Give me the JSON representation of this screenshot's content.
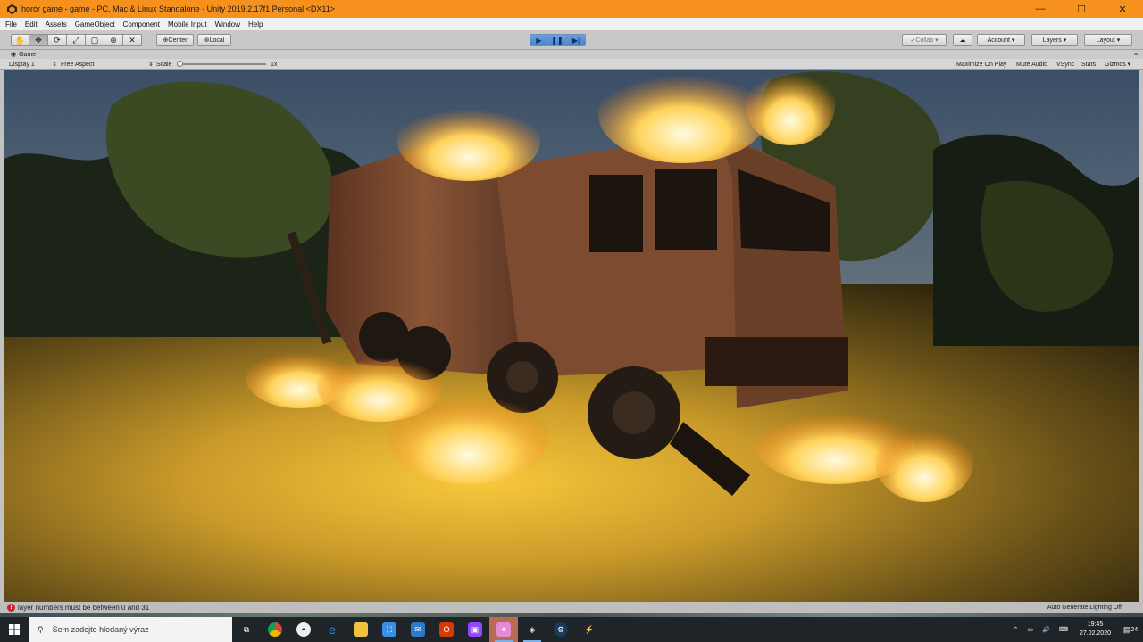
{
  "window": {
    "title": "horor game - game - PC, Mac & Linux Standalone - Unity 2019.2.17f1 Personal <DX11>",
    "min_glyph": "—",
    "max_glyph": "☐",
    "close_glyph": "✕"
  },
  "menu": [
    "File",
    "Edit",
    "Assets",
    "GameObject",
    "Component",
    "Mobile Input",
    "Window",
    "Help"
  ],
  "toolbar": {
    "tools": [
      "hand-tool",
      "move-tool",
      "rotate-tool",
      "scale-tool",
      "rect-tool",
      "transform-tool",
      "custom-tool"
    ],
    "tool_glyphs": [
      "✋",
      "✥",
      "⟳",
      "⤢",
      "▢",
      "⊕",
      "✕"
    ],
    "active_tool_index": 1,
    "pivot_mode": "Center",
    "pivot_rotation": "Local",
    "play_glyph": "▶",
    "pause_glyph": "❚❚",
    "step_glyph": "▶|",
    "collab": "Collab ▾",
    "cloud_glyph": "☁",
    "account": "Account",
    "layers": "Layers",
    "layout": "Layout"
  },
  "game_view": {
    "tab_label": "Game",
    "display": "Display 1",
    "aspect": "Free Aspect",
    "scale_label": "Scale",
    "scale_value": "1x",
    "maximize_on_play": "Maximize On Play",
    "mute_audio": "Mute Audio",
    "vsync": "VSync",
    "stats": "Stats",
    "gizmos": "Gizmos"
  },
  "status": {
    "error_icon": "!",
    "message": "layer numbers must be between 0 and 31",
    "right_text": "Auto Generate Lighting Off"
  },
  "taskbar": {
    "search_placeholder": "Sem zadejte hledaný výraz",
    "time": "19:45",
    "date": "27.02.2020",
    "notification_count": "24"
  }
}
